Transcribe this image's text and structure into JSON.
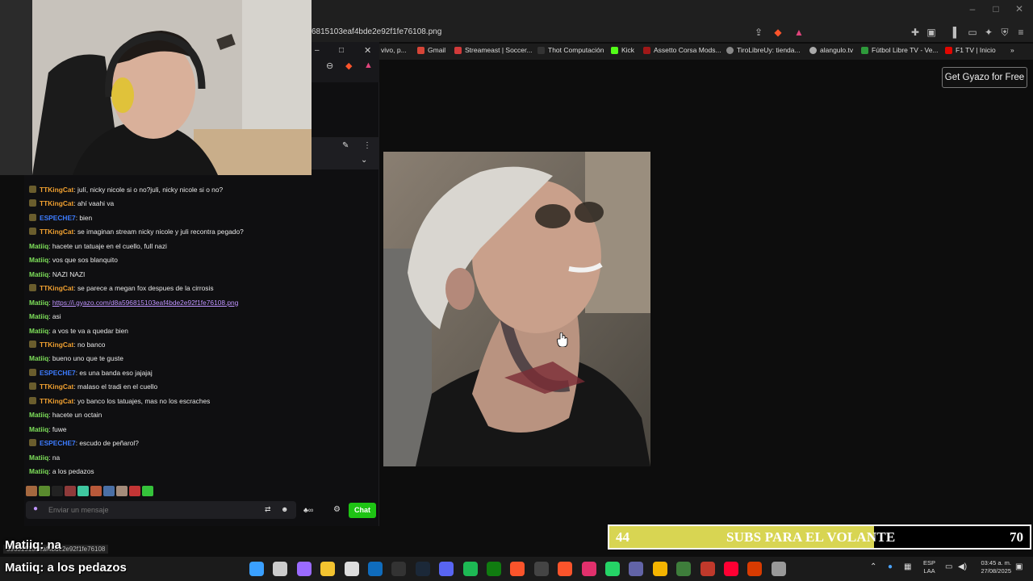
{
  "browser": {
    "url": "6815103eaf4bde2e92f1fe76108.png",
    "window_controls": [
      "–",
      "□",
      "✕"
    ],
    "bookmarks": [
      "vivo, p...",
      "Gmail",
      "Streameast | Soccer...",
      "Thot Computación",
      "Kick",
      "Assetto Corsa Mods...",
      "TiroLibreUy: tienda...",
      "alangulo.tv",
      "Fútbol Libre TV - Ve...",
      "F1 TV | Inicio"
    ],
    "more_bookmarks": "»"
  },
  "gyazo": {
    "button_label": "Get Gyazo for Free"
  },
  "chat": {
    "messages": [
      {
        "user": "TTKingCat",
        "text": ": julí, nicky nicole si o no?juli, nicky nicole si o no?",
        "color": "#f0a030",
        "badge": true
      },
      {
        "user": "TTKingCat",
        "text": ": ahí vaahi va",
        "color": "#f0a030",
        "badge": true
      },
      {
        "user": "ESPECHE7",
        "text": ": bien",
        "color": "#3d7cff",
        "badge": true
      },
      {
        "user": "TTKingCat",
        "text": ": se imaginan stream nicky nicole y juli recontra pegado?",
        "color": "#f0a030",
        "badge": true
      },
      {
        "user": "Matiiq",
        "text": ": hacete un tatuaje en el cuello, full nazi",
        "color": "#7ee05a",
        "badge": false
      },
      {
        "user": "Matiiq",
        "text": ": vos que sos blanquito",
        "color": "#7ee05a",
        "badge": false
      },
      {
        "user": "Matiiq",
        "text": ": NAZI NAZI",
        "color": "#7ee05a",
        "badge": false
      },
      {
        "user": "TTKingCat",
        "text": ": se parece a megan fox despues de la cirrosis",
        "color": "#f0a030",
        "badge": true
      },
      {
        "user": "Matiiq",
        "text": ": ",
        "link": "https://i.gyazo.com/d8a596815103eaf4bde2e92f1fe76108.png",
        "color": "#7ee05a",
        "badge": false
      },
      {
        "user": "Matiiq",
        "text": ": asi",
        "color": "#7ee05a",
        "badge": false
      },
      {
        "user": "Matiiq",
        "text": ": a vos te va a quedar bien",
        "color": "#7ee05a",
        "badge": false
      },
      {
        "user": "TTKingCat",
        "text": ": no banco",
        "color": "#f0a030",
        "badge": true
      },
      {
        "user": "Matiiq",
        "text": ": bueno uno que te guste",
        "color": "#7ee05a",
        "badge": false
      },
      {
        "user": "ESPECHE7",
        "text": ": es una banda eso jajajaj",
        "color": "#3d7cff",
        "badge": true
      },
      {
        "user": "TTKingCat",
        "text": ": malaso el tradi en el cuello",
        "color": "#f0a030",
        "badge": true
      },
      {
        "user": "TTKingCat",
        "text": ": yo banco los tatuajes, mas no los escraches",
        "color": "#f0a030",
        "badge": true
      },
      {
        "user": "Matiiq",
        "text": ": hacete un octain",
        "color": "#7ee05a",
        "badge": false
      },
      {
        "user": "Matiiq",
        "text": ": fuwe",
        "color": "#7ee05a",
        "badge": false
      },
      {
        "user": "ESPECHE7",
        "text": ": escudo de peñarol?",
        "color": "#3d7cff",
        "badge": true
      },
      {
        "user": "Matiiq",
        "text": ": na",
        "color": "#7ee05a",
        "badge": false
      },
      {
        "user": "Matiiq",
        "text": ": a los pedazos",
        "color": "#7ee05a",
        "badge": false
      }
    ],
    "input_placeholder": "Enviar un mensaje",
    "send_label": "Chat"
  },
  "overlay": {
    "line1_user": "Matiiq",
    "line1_text": ": na",
    "line2_user": "Matiiq",
    "line2_text": ": a los pedazos",
    "status_url": "596815103eaf4bde2e92f1fe76108"
  },
  "subs_goal": {
    "current": "44",
    "label": "SUBS PARA EL VOLANTE",
    "goal": "70",
    "progress": 0.63,
    "fill_color": "#d8d552"
  },
  "taskbar": {
    "lang": "ESP",
    "lang_sub": "LAA",
    "time": "03:45 a. m.",
    "date": "27/08/2025"
  }
}
